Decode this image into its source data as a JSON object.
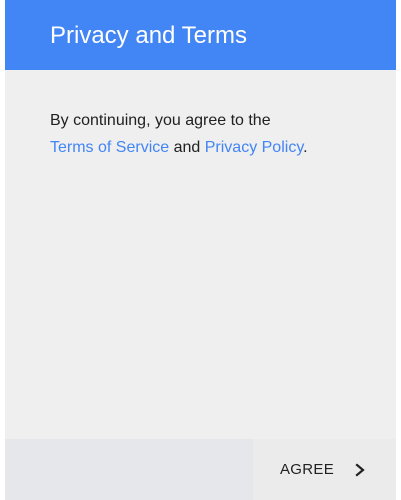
{
  "header": {
    "title": "Privacy and Terms"
  },
  "body": {
    "line1": "By continuing, you agree to the",
    "terms_link": "Terms of Service",
    "conjunction": " and ",
    "privacy_link": "Privacy Policy",
    "period": "."
  },
  "footer": {
    "agree_label": "AGREE",
    "agree_icon": "chevron-right-icon"
  },
  "colors": {
    "accent": "#4285f4",
    "text": "#212121",
    "background": "#efefef",
    "footer": "#e5e7eb"
  }
}
